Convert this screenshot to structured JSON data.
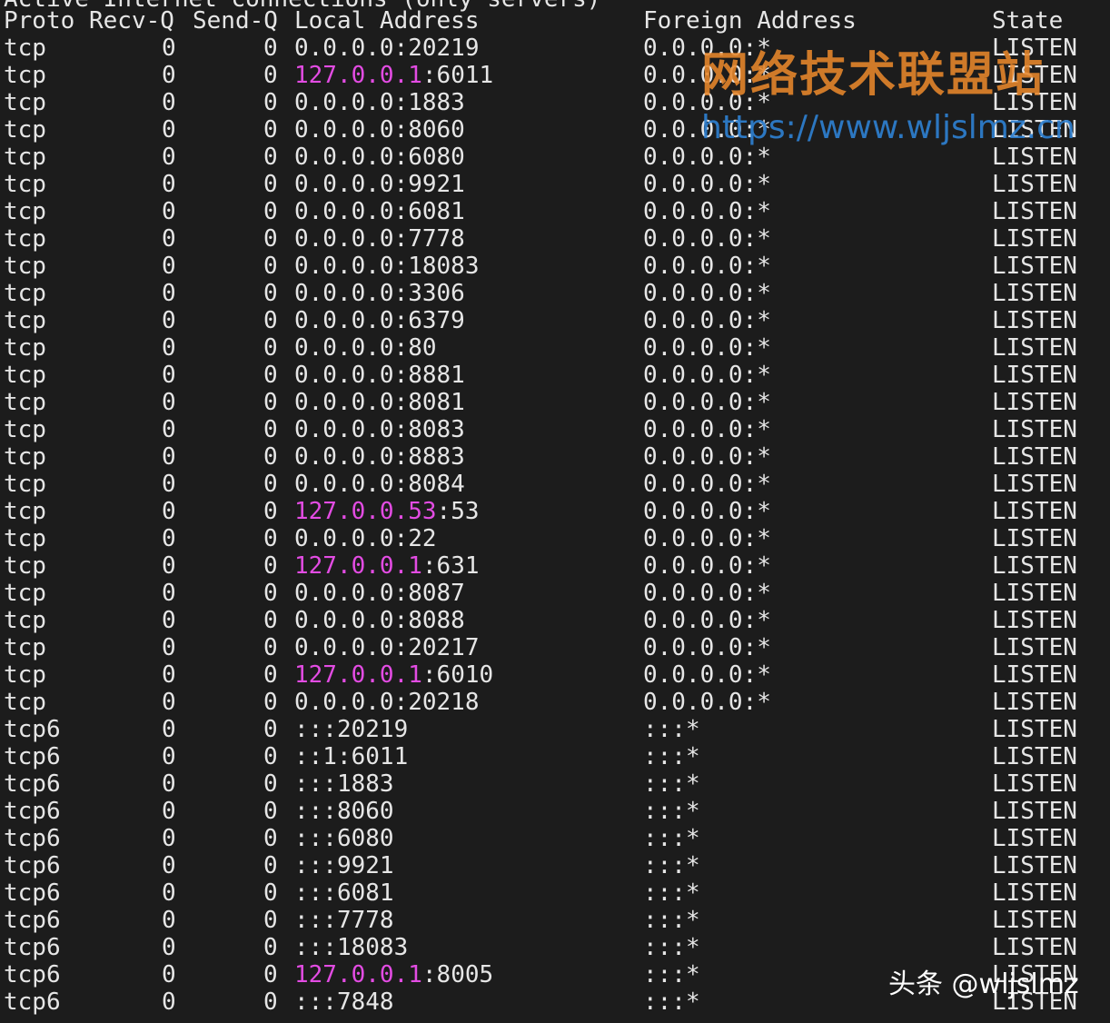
{
  "terminal": {
    "title_partial": "Active Internet connections (only servers)",
    "headers": {
      "proto": "Proto",
      "recv_q": "Recv-Q",
      "send_q": "Send-Q",
      "local": "Local Address",
      "foreign": "Foreign Address",
      "state": "State"
    },
    "highlight_color": "#e34ce3",
    "rows": [
      {
        "proto": "tcp",
        "recv": "0",
        "send": "0",
        "local_pre": "",
        "local_hl": "",
        "local_post": "0.0.0.0:20219",
        "foreign": "0.0.0.0:*",
        "state": "LISTEN"
      },
      {
        "proto": "tcp",
        "recv": "0",
        "send": "0",
        "local_pre": "",
        "local_hl": "127.0.0.1",
        "local_post": ":6011",
        "foreign": "0.0.0.0:*",
        "state": "LISTEN"
      },
      {
        "proto": "tcp",
        "recv": "0",
        "send": "0",
        "local_pre": "",
        "local_hl": "",
        "local_post": "0.0.0.0:1883",
        "foreign": "0.0.0.0:*",
        "state": "LISTEN"
      },
      {
        "proto": "tcp",
        "recv": "0",
        "send": "0",
        "local_pre": "",
        "local_hl": "",
        "local_post": "0.0.0.0:8060",
        "foreign": "0.0.0.0:*",
        "state": "LISTEN"
      },
      {
        "proto": "tcp",
        "recv": "0",
        "send": "0",
        "local_pre": "",
        "local_hl": "",
        "local_post": "0.0.0.0:6080",
        "foreign": "0.0.0.0:*",
        "state": "LISTEN"
      },
      {
        "proto": "tcp",
        "recv": "0",
        "send": "0",
        "local_pre": "",
        "local_hl": "",
        "local_post": "0.0.0.0:9921",
        "foreign": "0.0.0.0:*",
        "state": "LISTEN"
      },
      {
        "proto": "tcp",
        "recv": "0",
        "send": "0",
        "local_pre": "",
        "local_hl": "",
        "local_post": "0.0.0.0:6081",
        "foreign": "0.0.0.0:*",
        "state": "LISTEN"
      },
      {
        "proto": "tcp",
        "recv": "0",
        "send": "0",
        "local_pre": "",
        "local_hl": "",
        "local_post": "0.0.0.0:7778",
        "foreign": "0.0.0.0:*",
        "state": "LISTEN"
      },
      {
        "proto": "tcp",
        "recv": "0",
        "send": "0",
        "local_pre": "",
        "local_hl": "",
        "local_post": "0.0.0.0:18083",
        "foreign": "0.0.0.0:*",
        "state": "LISTEN"
      },
      {
        "proto": "tcp",
        "recv": "0",
        "send": "0",
        "local_pre": "",
        "local_hl": "",
        "local_post": "0.0.0.0:3306",
        "foreign": "0.0.0.0:*",
        "state": "LISTEN"
      },
      {
        "proto": "tcp",
        "recv": "0",
        "send": "0",
        "local_pre": "",
        "local_hl": "",
        "local_post": "0.0.0.0:6379",
        "foreign": "0.0.0.0:*",
        "state": "LISTEN"
      },
      {
        "proto": "tcp",
        "recv": "0",
        "send": "0",
        "local_pre": "",
        "local_hl": "",
        "local_post": "0.0.0.0:80",
        "foreign": "0.0.0.0:*",
        "state": "LISTEN"
      },
      {
        "proto": "tcp",
        "recv": "0",
        "send": "0",
        "local_pre": "",
        "local_hl": "",
        "local_post": "0.0.0.0:8881",
        "foreign": "0.0.0.0:*",
        "state": "LISTEN"
      },
      {
        "proto": "tcp",
        "recv": "0",
        "send": "0",
        "local_pre": "",
        "local_hl": "",
        "local_post": "0.0.0.0:8081",
        "foreign": "0.0.0.0:*",
        "state": "LISTEN"
      },
      {
        "proto": "tcp",
        "recv": "0",
        "send": "0",
        "local_pre": "",
        "local_hl": "",
        "local_post": "0.0.0.0:8083",
        "foreign": "0.0.0.0:*",
        "state": "LISTEN"
      },
      {
        "proto": "tcp",
        "recv": "0",
        "send": "0",
        "local_pre": "",
        "local_hl": "",
        "local_post": "0.0.0.0:8883",
        "foreign": "0.0.0.0:*",
        "state": "LISTEN"
      },
      {
        "proto": "tcp",
        "recv": "0",
        "send": "0",
        "local_pre": "",
        "local_hl": "",
        "local_post": "0.0.0.0:8084",
        "foreign": "0.0.0.0:*",
        "state": "LISTEN"
      },
      {
        "proto": "tcp",
        "recv": "0",
        "send": "0",
        "local_pre": "",
        "local_hl": "127.0.0.53",
        "local_post": ":53",
        "foreign": "0.0.0.0:*",
        "state": "LISTEN"
      },
      {
        "proto": "tcp",
        "recv": "0",
        "send": "0",
        "local_pre": "",
        "local_hl": "",
        "local_post": "0.0.0.0:22",
        "foreign": "0.0.0.0:*",
        "state": "LISTEN"
      },
      {
        "proto": "tcp",
        "recv": "0",
        "send": "0",
        "local_pre": "",
        "local_hl": "127.0.0.1",
        "local_post": ":631",
        "foreign": "0.0.0.0:*",
        "state": "LISTEN"
      },
      {
        "proto": "tcp",
        "recv": "0",
        "send": "0",
        "local_pre": "",
        "local_hl": "",
        "local_post": "0.0.0.0:8087",
        "foreign": "0.0.0.0:*",
        "state": "LISTEN"
      },
      {
        "proto": "tcp",
        "recv": "0",
        "send": "0",
        "local_pre": "",
        "local_hl": "",
        "local_post": "0.0.0.0:8088",
        "foreign": "0.0.0.0:*",
        "state": "LISTEN"
      },
      {
        "proto": "tcp",
        "recv": "0",
        "send": "0",
        "local_pre": "",
        "local_hl": "",
        "local_post": "0.0.0.0:20217",
        "foreign": "0.0.0.0:*",
        "state": "LISTEN"
      },
      {
        "proto": "tcp",
        "recv": "0",
        "send": "0",
        "local_pre": "",
        "local_hl": "127.0.0.1",
        "local_post": ":6010",
        "foreign": "0.0.0.0:*",
        "state": "LISTEN"
      },
      {
        "proto": "tcp",
        "recv": "0",
        "send": "0",
        "local_pre": "",
        "local_hl": "",
        "local_post": "0.0.0.0:20218",
        "foreign": "0.0.0.0:*",
        "state": "LISTEN"
      },
      {
        "proto": "tcp6",
        "recv": "0",
        "send": "0",
        "local_pre": "",
        "local_hl": "",
        "local_post": ":::20219",
        "foreign": ":::*",
        "state": "LISTEN"
      },
      {
        "proto": "tcp6",
        "recv": "0",
        "send": "0",
        "local_pre": "",
        "local_hl": "",
        "local_post": "::1:6011",
        "foreign": ":::*",
        "state": "LISTEN"
      },
      {
        "proto": "tcp6",
        "recv": "0",
        "send": "0",
        "local_pre": "",
        "local_hl": "",
        "local_post": ":::1883",
        "foreign": ":::*",
        "state": "LISTEN"
      },
      {
        "proto": "tcp6",
        "recv": "0",
        "send": "0",
        "local_pre": "",
        "local_hl": "",
        "local_post": ":::8060",
        "foreign": ":::*",
        "state": "LISTEN"
      },
      {
        "proto": "tcp6",
        "recv": "0",
        "send": "0",
        "local_pre": "",
        "local_hl": "",
        "local_post": ":::6080",
        "foreign": ":::*",
        "state": "LISTEN"
      },
      {
        "proto": "tcp6",
        "recv": "0",
        "send": "0",
        "local_pre": "",
        "local_hl": "",
        "local_post": ":::9921",
        "foreign": ":::*",
        "state": "LISTEN"
      },
      {
        "proto": "tcp6",
        "recv": "0",
        "send": "0",
        "local_pre": "",
        "local_hl": "",
        "local_post": ":::6081",
        "foreign": ":::*",
        "state": "LISTEN"
      },
      {
        "proto": "tcp6",
        "recv": "0",
        "send": "0",
        "local_pre": "",
        "local_hl": "",
        "local_post": ":::7778",
        "foreign": ":::*",
        "state": "LISTEN"
      },
      {
        "proto": "tcp6",
        "recv": "0",
        "send": "0",
        "local_pre": "",
        "local_hl": "",
        "local_post": ":::18083",
        "foreign": ":::*",
        "state": "LISTEN"
      },
      {
        "proto": "tcp6",
        "recv": "0",
        "send": "0",
        "local_pre": "",
        "local_hl": "127.0.0.1",
        "local_post": ":8005",
        "foreign": ":::*",
        "state": "LISTEN"
      },
      {
        "proto": "tcp6",
        "recv": "0",
        "send": "0",
        "local_pre": "",
        "local_hl": "",
        "local_post": ":::7848",
        "foreign": ":::*",
        "state": "LISTEN"
      }
    ]
  },
  "watermarks": {
    "site_name": "网络技术联盟站",
    "site_url": "https://www.wljslmz.cn",
    "platform_tag": "头条 @wljslmz"
  }
}
